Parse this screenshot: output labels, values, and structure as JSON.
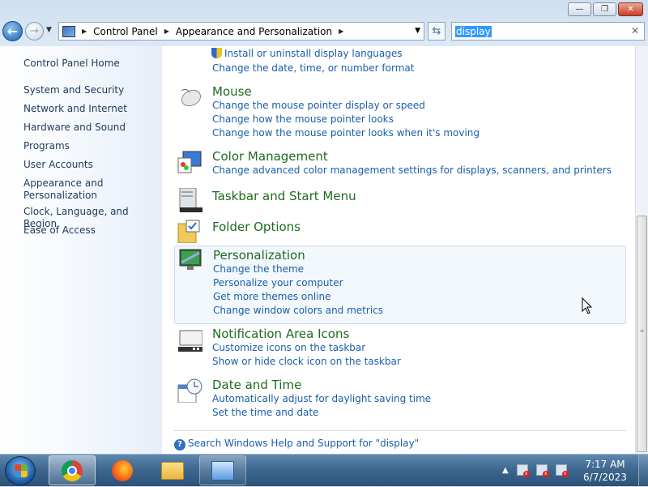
{
  "window": {
    "caption_buttons": {
      "minimize": "—",
      "restore": "❐",
      "close": "✕"
    }
  },
  "navbar": {
    "back_icon": "back-arrow-icon",
    "forward_icon": "forward-arrow-icon",
    "breadcrumbs": [
      "Control Panel",
      "Appearance and Personalization"
    ],
    "search_value": "display",
    "search_clear": "✕"
  },
  "sidebar": {
    "items": [
      "Control Panel Home",
      "System and Security",
      "Network and Internet",
      "Hardware and Sound",
      "Programs",
      "User Accounts",
      "Appearance and Personalization",
      "Clock, Language, and Region",
      "Ease of Access"
    ]
  },
  "content": {
    "top_links": [
      "Install or uninstall display languages",
      "Change the date, time, or number format"
    ],
    "categories": [
      {
        "title": "Mouse",
        "icon": "mouse-icon",
        "links": [
          "Change the mouse pointer display or speed",
          "Change how the mouse pointer looks",
          "Change how the mouse pointer looks when it's moving"
        ]
      },
      {
        "title": "Color Management",
        "icon": "color-management-icon",
        "links": [
          "Change advanced color management settings for displays, scanners, and printers"
        ]
      },
      {
        "title": "Taskbar and Start Menu",
        "icon": "taskbar-icon",
        "links": []
      },
      {
        "title": "Folder Options",
        "icon": "folder-options-icon",
        "links": []
      },
      {
        "title": "Personalization",
        "icon": "personalization-icon",
        "links": [
          "Change the theme",
          "Personalize your computer",
          "Get more themes online",
          "Change window colors and metrics"
        ]
      },
      {
        "title": "Notification Area Icons",
        "icon": "notification-area-icon",
        "links": [
          "Customize icons on the taskbar",
          "Show or hide clock icon on the taskbar"
        ]
      },
      {
        "title": "Date and Time",
        "icon": "date-time-icon",
        "links": [
          "Automatically adjust for daylight saving time",
          "Set the time and date"
        ]
      }
    ],
    "help_link": "Search Windows Help and Support for \"display\""
  },
  "taskbar": {
    "apps": [
      "chrome-icon",
      "firefox-icon",
      "file-explorer-icon",
      "control-panel-icon"
    ],
    "clock_time": "7:17 AM",
    "clock_date": "6/7/2023"
  }
}
